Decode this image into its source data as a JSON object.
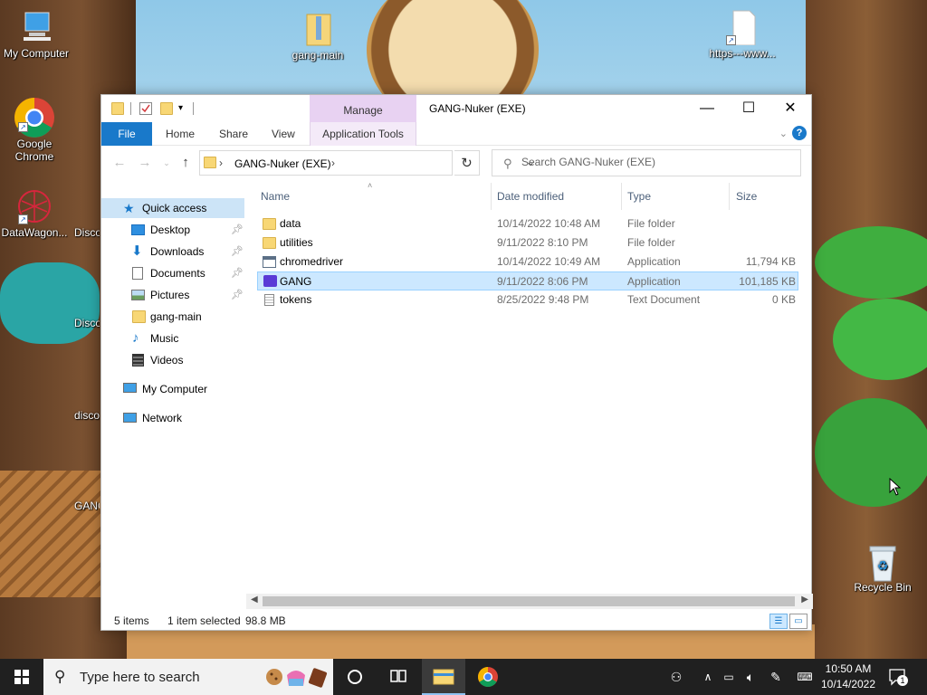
{
  "desktop": {
    "icons": [
      {
        "label": "My Computer"
      },
      {
        "label": "gang-main"
      },
      {
        "label": "https---www..."
      },
      {
        "label": "Google Chrome"
      },
      {
        "label": "DataWagon..."
      },
      {
        "label": "Disco"
      },
      {
        "label": "Disco"
      },
      {
        "label": "disco"
      },
      {
        "label": "GANG"
      },
      {
        "label": "Recycle Bin"
      }
    ]
  },
  "window": {
    "title": "GANG-Nuker (EXE)",
    "manage_tab": "Manage",
    "ribbon_tabs": {
      "file": "File",
      "home": "Home",
      "share": "Share",
      "view": "View",
      "app_tools": "Application Tools"
    },
    "help_icon": "?",
    "controls": {
      "minimize": "—",
      "maximize": "☐",
      "close": "✕"
    },
    "address": {
      "path": "GANG-Nuker (EXE)"
    },
    "search": {
      "placeholder": "Search GANG-Nuker (EXE)"
    },
    "nav_pane": [
      {
        "label": "Quick access",
        "icon": "star-icon"
      },
      {
        "label": "Desktop",
        "icon": "desktop-icon",
        "pinned": true
      },
      {
        "label": "Downloads",
        "icon": "download-icon",
        "pinned": true
      },
      {
        "label": "Documents",
        "icon": "documents-icon",
        "pinned": true
      },
      {
        "label": "Pictures",
        "icon": "pictures-icon",
        "pinned": true
      },
      {
        "label": "gang-main",
        "icon": "folder-icon"
      },
      {
        "label": "Music",
        "icon": "music-icon"
      },
      {
        "label": "Videos",
        "icon": "videos-icon"
      },
      {
        "label": "My Computer",
        "icon": "computer-icon"
      },
      {
        "label": "Network",
        "icon": "network-icon"
      }
    ],
    "columns": {
      "name": "Name",
      "date": "Date modified",
      "type": "Type",
      "size": "Size"
    },
    "files": [
      {
        "name": "data",
        "date": "10/14/2022 10:48 AM",
        "type": "File folder",
        "size": "",
        "icon": "folder-icon"
      },
      {
        "name": "utilities",
        "date": "9/11/2022 8:10 PM",
        "type": "File folder",
        "size": "",
        "icon": "folder-icon"
      },
      {
        "name": "chromedriver",
        "date": "10/14/2022 10:49 AM",
        "type": "Application",
        "size": "11,794 KB",
        "icon": "application-icon"
      },
      {
        "name": "GANG",
        "date": "9/11/2022 8:06 PM",
        "type": "Application",
        "size": "101,185 KB",
        "icon": "gang-app-icon",
        "selected": true
      },
      {
        "name": "tokens",
        "date": "8/25/2022 9:48 PM",
        "type": "Text Document",
        "size": "0 KB",
        "icon": "text-document-icon"
      }
    ],
    "status": {
      "items": "5 items",
      "selected": "1 item selected",
      "size": "98.8 MB"
    }
  },
  "taskbar": {
    "search_placeholder": "Type here to search",
    "time": "10:50 AM",
    "date": "10/14/2022",
    "notification_count": "1"
  },
  "colors": {
    "accent": "#1979ca",
    "selection": "#cce8ff",
    "manage_tab": "#e8d2f2",
    "taskbar": "#202020"
  }
}
